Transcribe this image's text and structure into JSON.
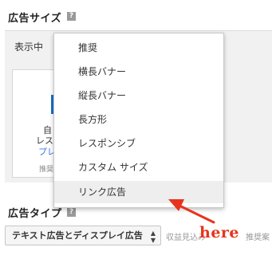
{
  "ad_size_section": {
    "title": "広告サイズ",
    "help_icon": "question-icon",
    "showing_label": "表示中",
    "preview": {
      "lines": [
        "自",
        "レス",
        "プレ"
      ],
      "recommended_label": "推奨"
    }
  },
  "dropdown": {
    "items": [
      {
        "label": "推奨"
      },
      {
        "label": "横長バナー"
      },
      {
        "label": "縦長バナー"
      },
      {
        "label": "長方形"
      },
      {
        "label": "レスポンシブ"
      },
      {
        "label": "カスタム サイズ"
      },
      {
        "label": "リンク広告"
      }
    ],
    "selected_index": 6
  },
  "ad_type_section": {
    "title": "広告タイプ",
    "help_icon": "question-icon",
    "select_value": "テキスト広告とディスプレイ広告",
    "revenue_text": "収益見込み",
    "recommended_text": "推奨案"
  },
  "annotation": {
    "text": "here",
    "color": "#e8331c"
  },
  "colors": {
    "accent_blue": "#3b78e7",
    "panel_bg": "#f1f1f1",
    "selected_bg": "#eeeeee"
  }
}
